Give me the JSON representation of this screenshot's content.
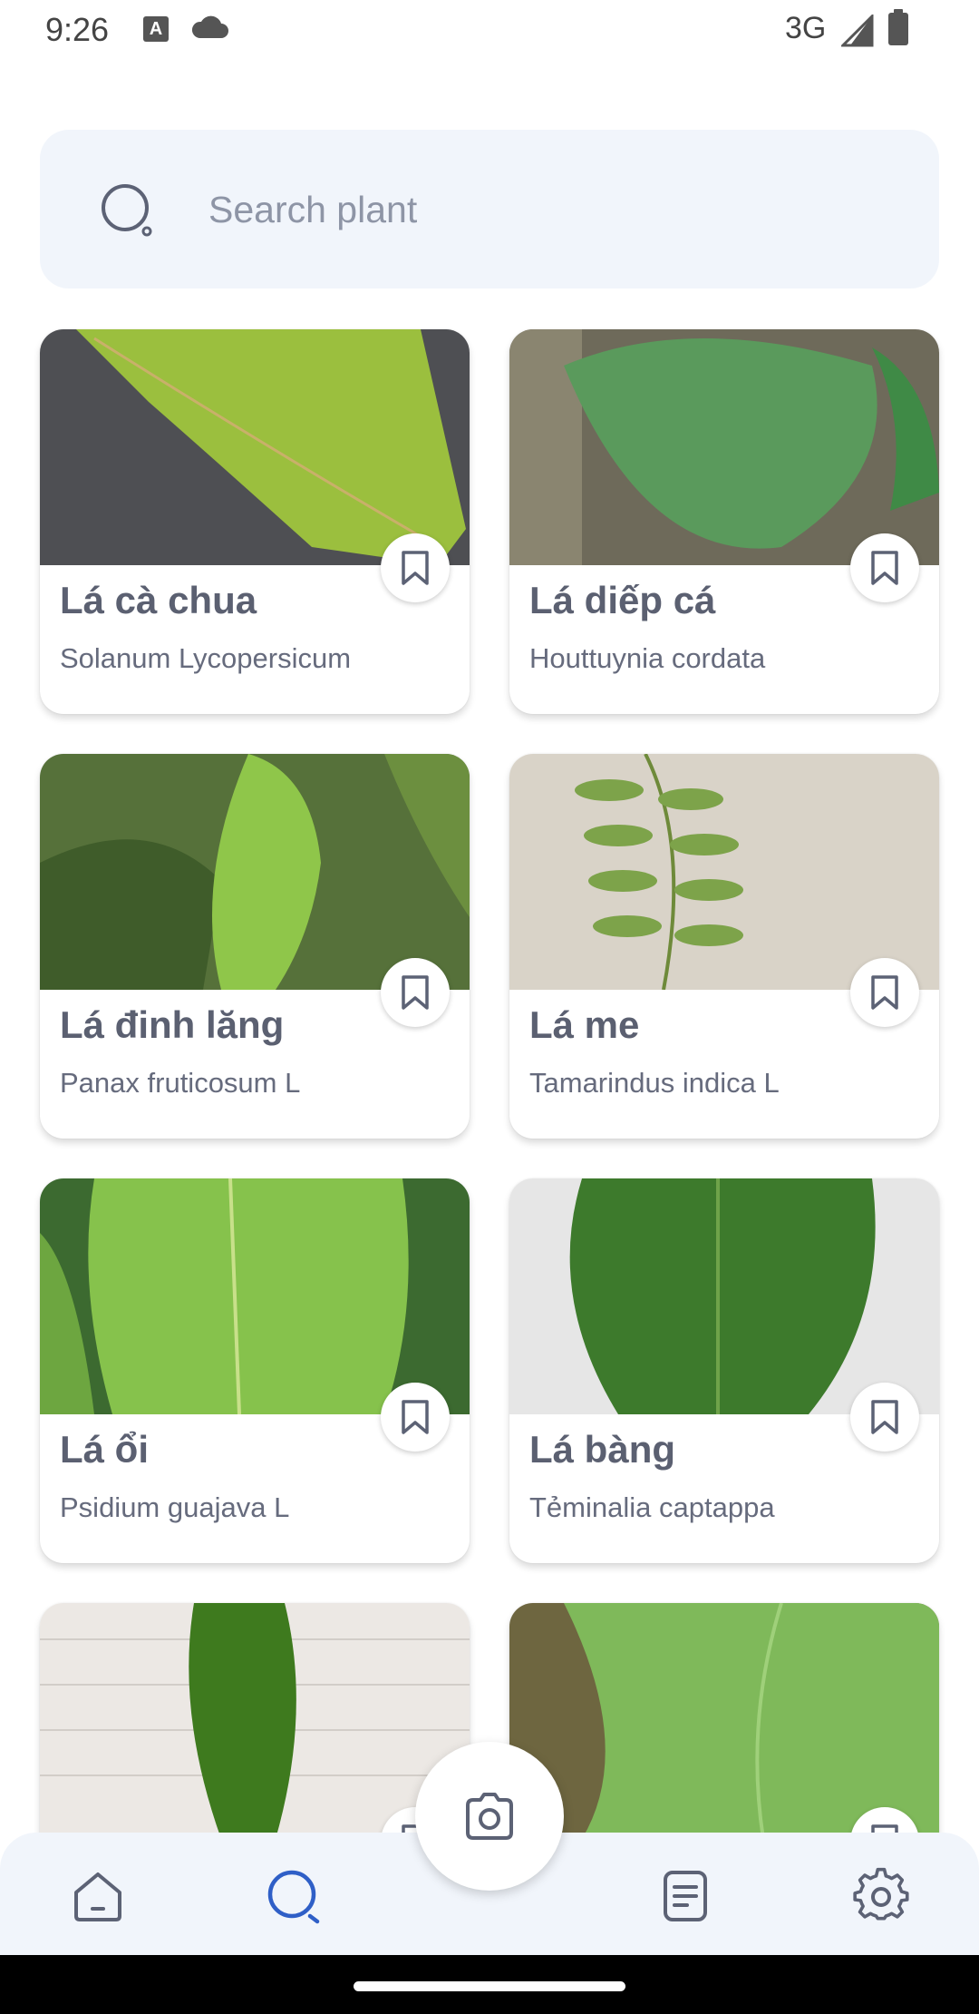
{
  "status_bar": {
    "time": "9:26",
    "network": "3G"
  },
  "search": {
    "placeholder": "Search plant",
    "value": ""
  },
  "plants": [
    {
      "name": "Lá cà chua",
      "scientific": "Solanum Lycopersicum"
    },
    {
      "name": "Lá diếp cá",
      "scientific": "Houttuynia cordata"
    },
    {
      "name": "Lá đinh lăng",
      "scientific": "Panax fruticosum L"
    },
    {
      "name": "Lá me",
      "scientific": "Tamarindus indica L"
    },
    {
      "name": "Lá ổi",
      "scientific": "Psidium guajava L"
    },
    {
      "name": "Lá bàng",
      "scientific": "Tẻminalia captappa"
    }
  ],
  "nav": {
    "items": [
      "home-icon",
      "search-icon",
      "camera-icon",
      "notes-icon",
      "settings-icon"
    ],
    "active": "search",
    "active_color": "#2f5fc7",
    "inactive_color": "#5c6275"
  }
}
